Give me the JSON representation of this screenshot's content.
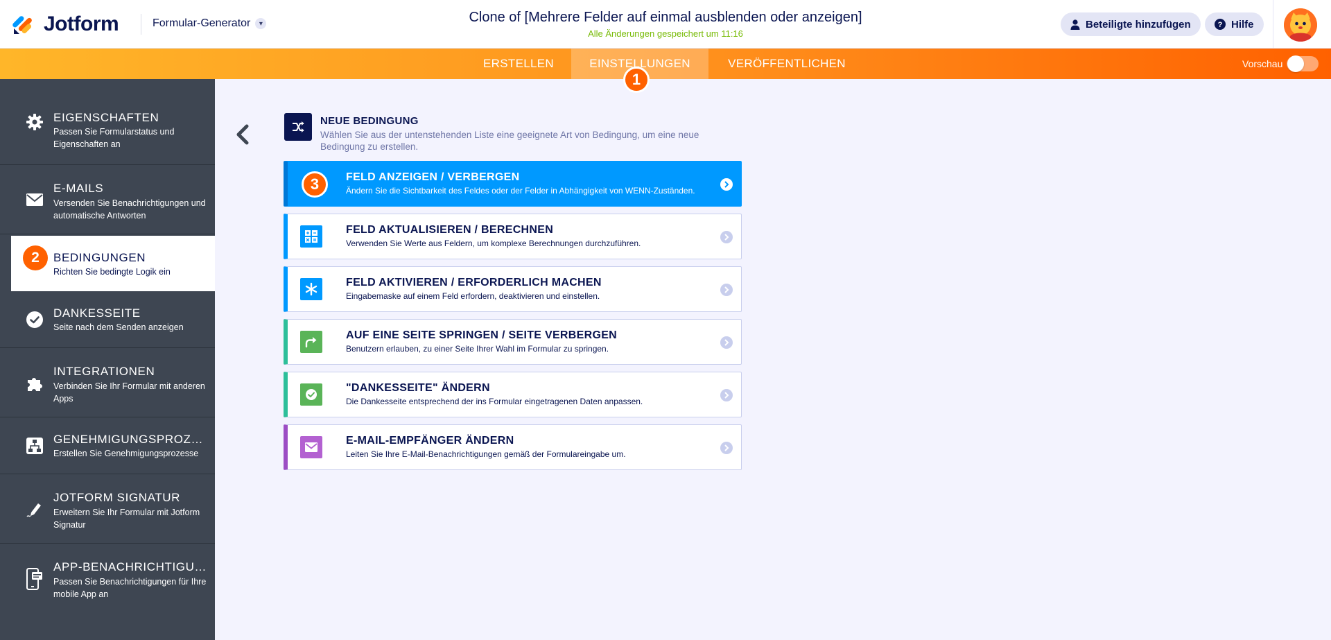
{
  "header": {
    "logo_text": "Jotform",
    "builder_label": "Formular-Generator",
    "form_title": "Clone of [Mehrere Felder auf einmal ausblenden oder anzeigen]",
    "saved_status": "Alle Änderungen gespeichert um 11:16",
    "add_collaborators": "Beteiligte hinzufügen",
    "help": "Hilfe"
  },
  "nav": {
    "tabs": [
      "ERSTELLEN",
      "EINSTELLUNGEN",
      "VERÖFFENTLICHEN"
    ],
    "active_tab": "EINSTELLUNGEN",
    "preview_label": "Vorschau",
    "preview_on": false
  },
  "steps": [
    "1",
    "2",
    "3"
  ],
  "sidebar": {
    "items": [
      {
        "title": "EIGENSCHAFTEN",
        "desc": "Passen Sie Formularstatus und Eigenschaften an",
        "icon": "gear-icon"
      },
      {
        "title": "E-MAILS",
        "desc": "Versenden Sie Benachrichtigungen und automatische Antworten",
        "icon": "envelope-icon"
      },
      {
        "title": "BEDINGUNGEN",
        "desc": "Richten Sie bedingte Logik ein",
        "icon": "step-badge",
        "active": true
      },
      {
        "title": "DANKESSEITE",
        "desc": "Seite nach dem Senden anzeigen",
        "icon": "check-circle-icon"
      },
      {
        "title": "INTEGRATIONEN",
        "desc": "Verbinden Sie Ihr Formular mit anderen Apps",
        "icon": "puzzle-icon"
      },
      {
        "title": "GENEHMIGUNGSPROZESSE",
        "desc": "Erstellen Sie Genehmigungsprozesse",
        "icon": "workflow-icon"
      },
      {
        "title": "JOTFORM SIGNATUR",
        "desc": "Erweitern Sie Ihr Formular mit Jotform Signatur",
        "icon": "signature-pen-icon"
      },
      {
        "title": "APP-BENACHRICHTIGUNG",
        "desc": "Passen Sie Benachrichtigungen für Ihre mobile App an",
        "icon": "mobile-notification-icon"
      }
    ]
  },
  "new_condition": {
    "title": "NEUE BEDINGUNG",
    "desc": "Wählen Sie aus der untenstehenden Liste eine geeignete Art von Bedingung, um eine neue Bedingung zu erstellen."
  },
  "conditions": [
    {
      "title": "FELD ANZEIGEN / VERBERGEN",
      "desc": "Ändern Sie die Sichtbarkeit des Feldes oder der Felder in Abhängigkeit von WENN-Zuständen.",
      "color": "#0099ff",
      "selected": true
    },
    {
      "title": "FELD AKTUALISIEREN / BERECHNEN",
      "desc": "Verwenden Sie Werte aus Feldern, um komplexe Berechnungen durchzuführen.",
      "color": "#0099ff"
    },
    {
      "title": "FELD AKTIVIEREN / ERFORDERLICH MACHEN",
      "desc": "Eingabemaske auf einem Feld erfordern, deaktivieren und einstellen.",
      "color": "#0099ff"
    },
    {
      "title": "AUF EINE SEITE SPRINGEN / SEITE VERBERGEN",
      "desc": "Benutzern erlauben, zu einer Seite Ihrer Wahl im Formular zu springen.",
      "color": "#5ab458"
    },
    {
      "title": "\"DANKESSEITE\" ÄNDERN",
      "desc": "Die Dankesseite entsprechend der ins Formular eingetragenen Daten anpassen.",
      "color": "#5ab458"
    },
    {
      "title": "E-MAIL-EMPFÄNGER ÄNDERN",
      "desc": "Leiten Sie Ihre E-Mail-Benachrichtigungen gemäß der Formulareingabe um.",
      "color": "#b361d1"
    }
  ]
}
